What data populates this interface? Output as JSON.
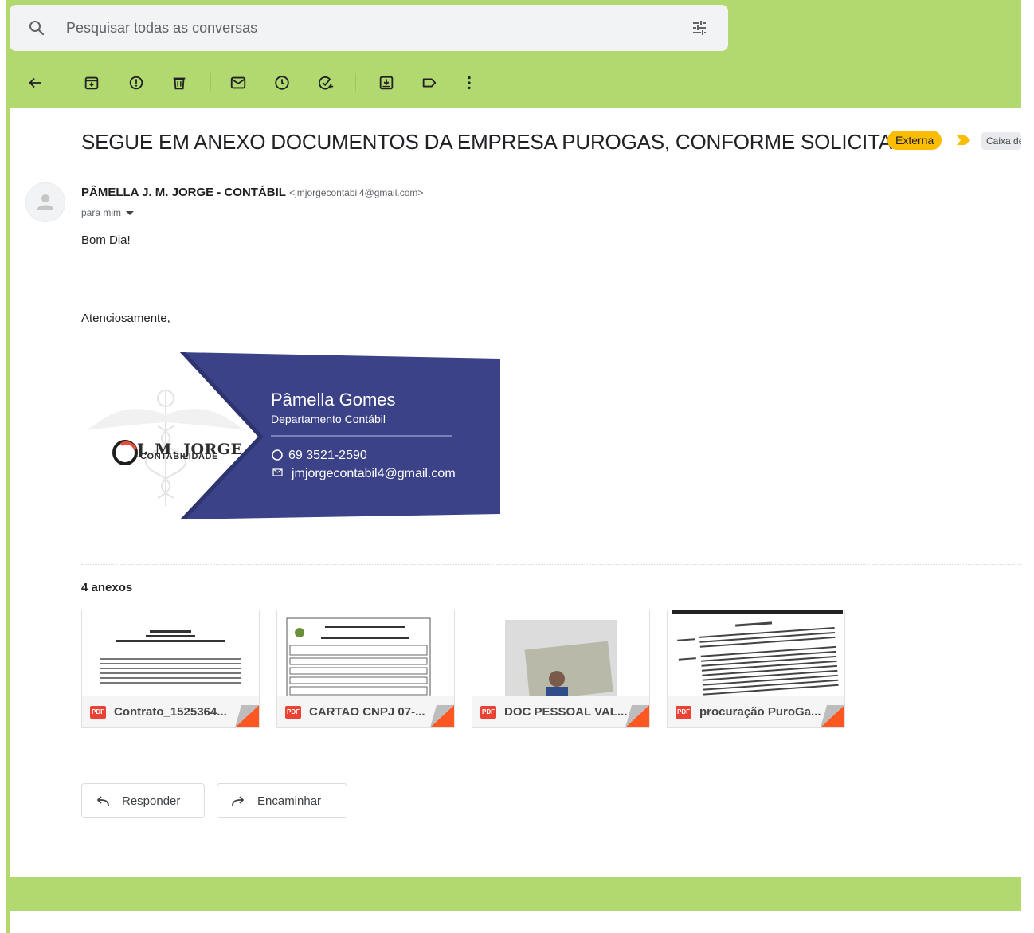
{
  "search": {
    "placeholder": "Pesquisar todas as conversas"
  },
  "toolbar": {
    "buttons": [
      {
        "name": "back-arrow-icon"
      },
      {
        "name": "archive-icon"
      },
      {
        "name": "report-spam-icon"
      },
      {
        "name": "delete-icon"
      },
      {
        "name": "mark-unread-icon"
      },
      {
        "name": "snooze-icon"
      },
      {
        "name": "add-task-icon"
      },
      {
        "name": "move-to-icon"
      },
      {
        "name": "label-icon"
      },
      {
        "name": "more-vert-icon"
      }
    ]
  },
  "email": {
    "subject": "SEGUE EM ANEXO DOCUMENTOS DA EMPRESA PUROGAS, CONFORME SOLICITADO.",
    "badge": "Externa",
    "label": "Caixa de entrada",
    "sender_name": "PÂMELLA J. M. JORGE - CONTÁBIL",
    "sender_email": "<jmjorgecontabil4@gmail.com>",
    "to": "para mim",
    "greeting": "Bom Dia!",
    "closing": "Atenciosamente,"
  },
  "signature": {
    "name": "Pâmella Gomes",
    "department": "Departamento Contábil",
    "phone": "69 3521-2590",
    "email": "jmjorgecontabil4@gmail.com",
    "logo_title": "J. M. JORGE",
    "logo_subtitle": "CONTABILIDADE"
  },
  "attachments": {
    "count_label": "4 anexos",
    "items": [
      {
        "name": "Contrato_1525364..."
      },
      {
        "name": "CARTAO CNPJ 07-..."
      },
      {
        "name": "DOC PESSOAL VAL..."
      },
      {
        "name": "procuração PuroGa..."
      }
    ],
    "pdf_badge": "PDF"
  },
  "actions": {
    "reply": "Responder",
    "forward": "Encaminhar"
  },
  "colors": {
    "frame_green": "#b1d96f",
    "signature_blue": "#3b4287",
    "badge_yellow": "#fbbc04",
    "pdf_red": "#ea4335"
  }
}
